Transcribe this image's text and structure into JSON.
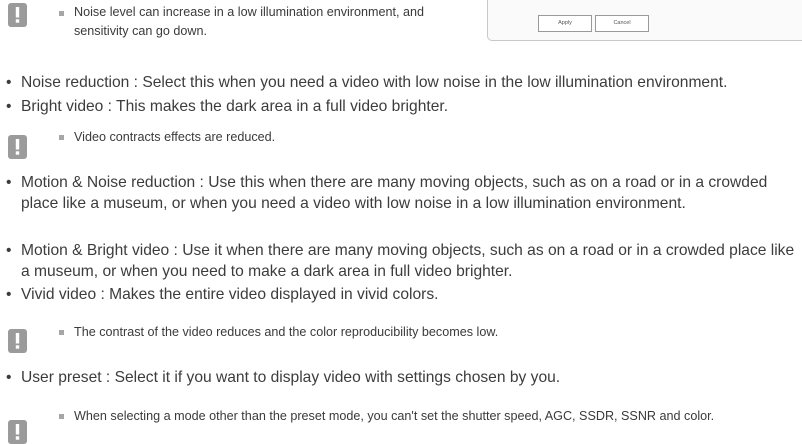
{
  "panel": {
    "apply_label": "Apply",
    "cancel_label": "Cancel"
  },
  "notes": [
    {
      "text": "Noise level can increase in a low illumination environment, and sensitivity can go down."
    },
    {
      "text": "Video contracts effects are reduced."
    },
    {
      "text": "The contrast of the video reduces and the color reproducibility becomes low."
    },
    {
      "text": "When selecting a mode other than the preset mode, you can't set the shutter speed, AGC, SSDR, SSNR and color."
    }
  ],
  "items": [
    {
      "text": "Noise reduction : Select this when you need a video with low noise in the low illumination environment."
    },
    {
      "text": "Bright video : This makes the dark area in a full video brighter."
    },
    {
      "text": "Motion & Noise reduction : Use this when there are many moving objects, such as on a road or in a crowded place like a museum, or when you need a video with low noise in a low illumination environment."
    },
    {
      "text": "Motion & Bright video : Use it when there are many moving objects, such as on a road or in a crowded place like a museum, or when you need to make a dark area in full video brighter."
    },
    {
      "text": "Vivid video : Makes the entire video displayed in vivid colors."
    },
    {
      "text": "User preset : Select it if you want to display video with settings chosen by you."
    }
  ],
  "colors": {
    "note_icon": "#9b9b9b",
    "text": "#3c3c3c"
  }
}
